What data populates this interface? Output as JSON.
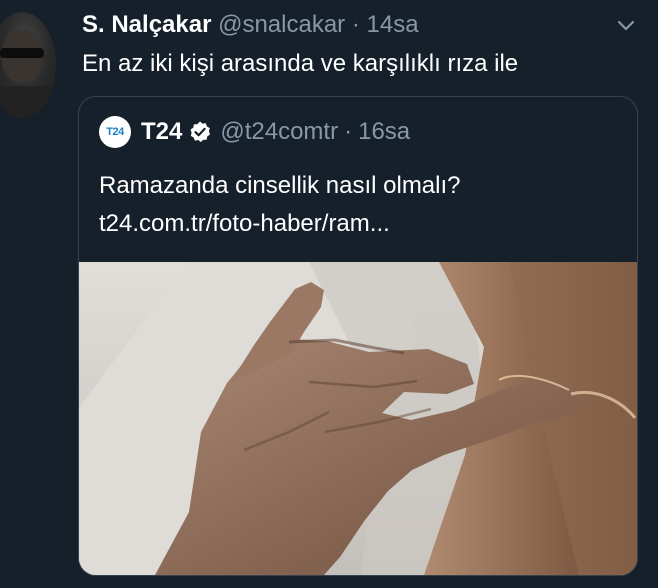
{
  "tweet": {
    "author_name": "S. Nalçakar",
    "author_handle": "@snalcakar",
    "separator": "·",
    "time": "14sa",
    "text": "En az iki kişi arasında ve karşılıklı rıza ile",
    "avatar_icon": "profile-photo",
    "menu_icon": "chevron-down-icon"
  },
  "quote": {
    "avatar_text": "T24",
    "author_name": "T24",
    "verified_icon": "verified-badge-icon",
    "author_handle": "@t24comtr",
    "separator": "·",
    "time": "16sa",
    "text": "Ramazanda cinsellik nasıl olmalı?",
    "link": "t24.com.tr/foto-haber/ram...",
    "image_description_icon": "photo-thumbnail"
  },
  "colors": {
    "background": "#15202b",
    "text_primary": "#ffffff",
    "text_secondary": "#8899a6",
    "border": "#38444d",
    "verified_badge": "#ffffff",
    "t24_blue": "#1583c5"
  }
}
